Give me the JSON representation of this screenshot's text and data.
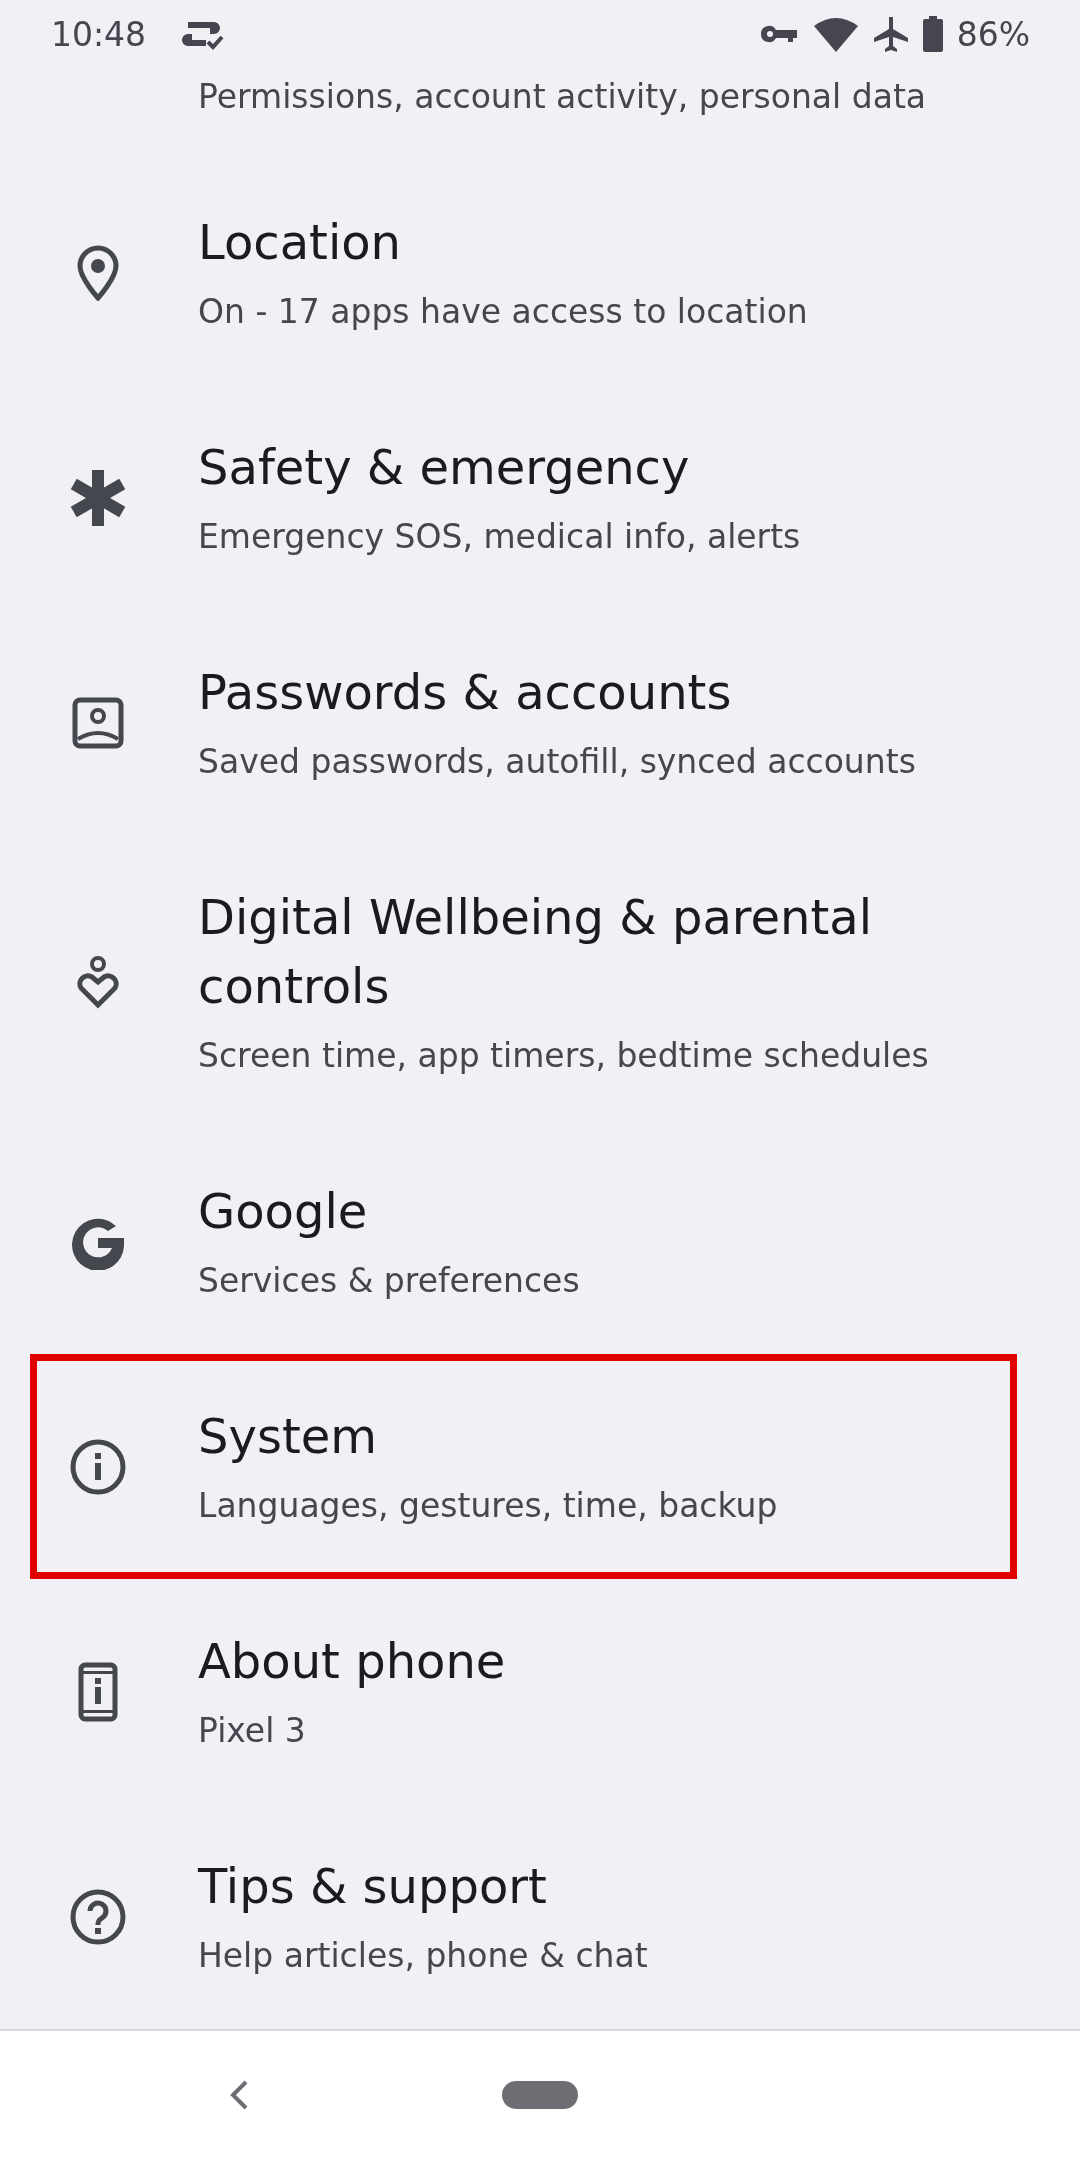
{
  "status_bar": {
    "time": "10:48",
    "battery": "86%"
  },
  "partial_item": {
    "subtitle": "Permissions, account activity, personal data"
  },
  "items": [
    {
      "kind": "location",
      "title": "Location",
      "subtitle": "On - 17 apps have access to location",
      "highlighted": false
    },
    {
      "kind": "safety",
      "title": "Safety & emergency",
      "subtitle": "Emergency SOS, medical info, alerts",
      "highlighted": false
    },
    {
      "kind": "accounts",
      "title": "Passwords & accounts",
      "subtitle": "Saved passwords, autofill, synced accounts",
      "highlighted": false
    },
    {
      "kind": "wellbeing",
      "title": "Digital Wellbeing & parental controls",
      "subtitle": "Screen time, app timers, bedtime schedules",
      "highlighted": false
    },
    {
      "kind": "google",
      "title": "Google",
      "subtitle": "Services & preferences",
      "highlighted": false
    },
    {
      "kind": "system",
      "title": "System",
      "subtitle": "Languages, gestures, time, backup",
      "highlighted": true
    },
    {
      "kind": "about",
      "title": "About phone",
      "subtitle": "Pixel 3",
      "highlighted": false
    },
    {
      "kind": "tips",
      "title": "Tips & support",
      "subtitle": "Help articles, phone & chat",
      "highlighted": false
    }
  ]
}
